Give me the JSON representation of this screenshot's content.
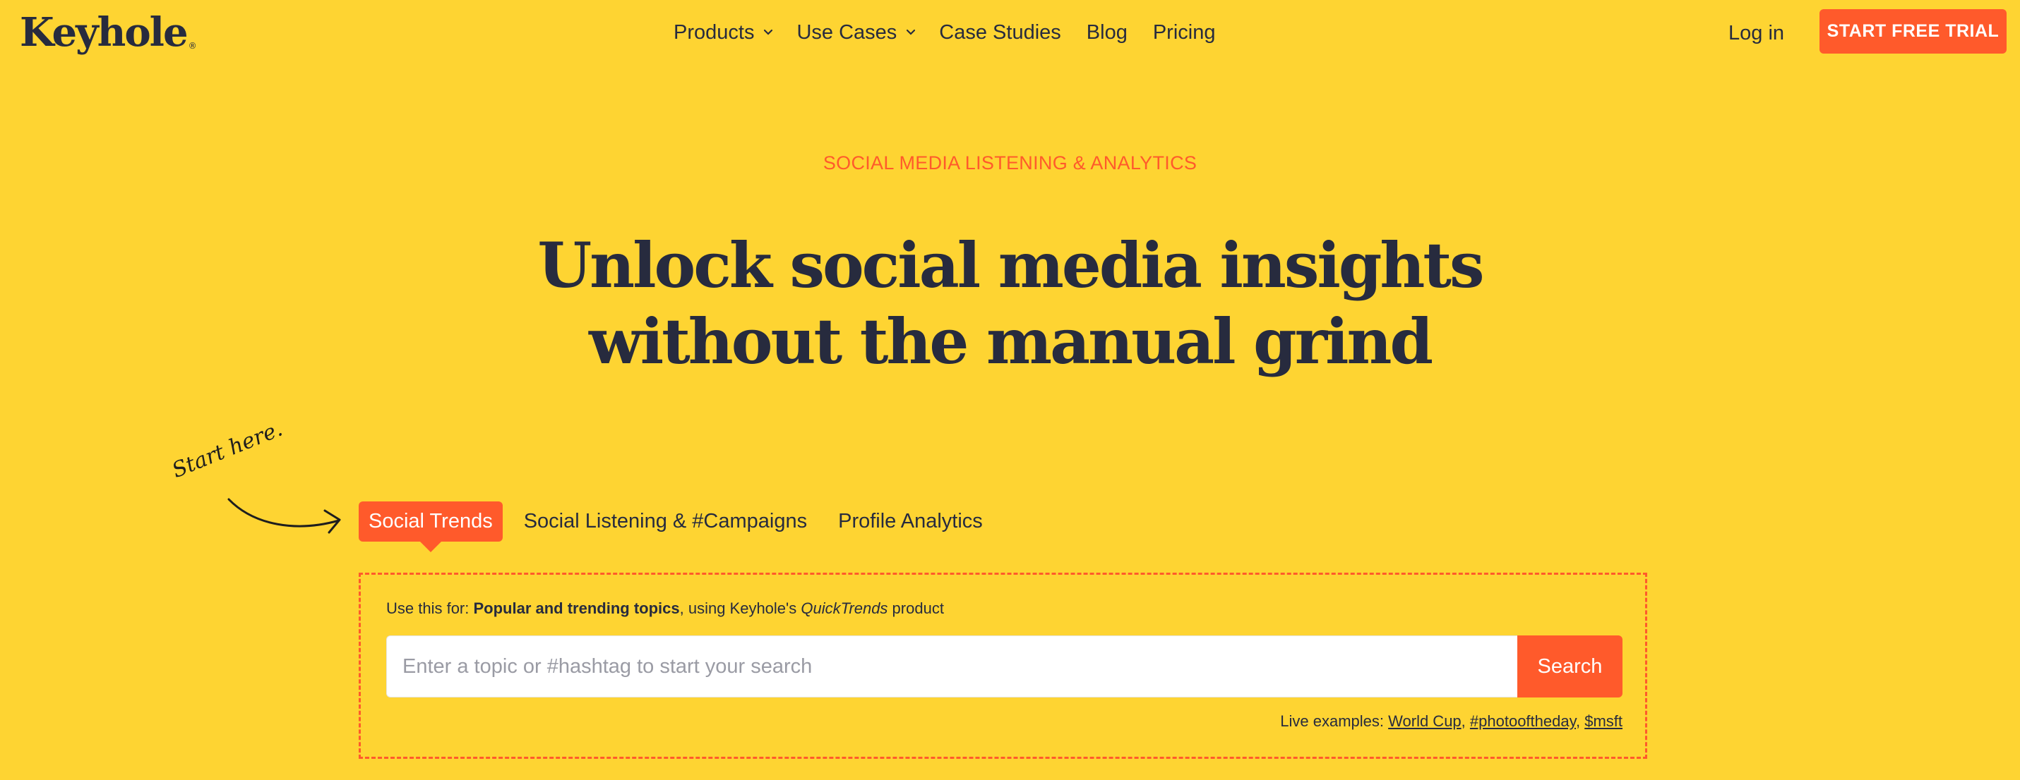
{
  "header": {
    "logo": "Keyhole",
    "logo_mark": "®",
    "nav": [
      {
        "label": "Products",
        "has_dropdown": true
      },
      {
        "label": "Use Cases",
        "has_dropdown": true
      },
      {
        "label": "Case Studies",
        "has_dropdown": false
      },
      {
        "label": "Blog",
        "has_dropdown": false
      },
      {
        "label": "Pricing",
        "has_dropdown": false
      }
    ],
    "login_label": "Log in",
    "cta_label": "START FREE TRIAL"
  },
  "hero": {
    "eyebrow": "SOCIAL MEDIA LISTENING & ANALYTICS",
    "headline_line1": "Unlock social media insights",
    "headline_line2": "without the manual grind"
  },
  "annotation": {
    "start_here": "Start here."
  },
  "tabs": [
    {
      "label": "Social Trends",
      "active": true
    },
    {
      "label": "Social Listening & #Campaigns",
      "active": false
    },
    {
      "label": "Profile Analytics",
      "active": false
    }
  ],
  "panel": {
    "use_for_prefix": "Use this for: ",
    "use_for_bold": "Popular and trending topics",
    "use_for_mid": ", using Keyhole's ",
    "use_for_product": "QuickTrends",
    "use_for_suffix": " product",
    "search_placeholder": "Enter a topic or #hashtag to start your search",
    "search_value": "",
    "search_button": "Search",
    "live_examples_label": "Live examples: ",
    "live_examples": [
      "World Cup",
      "#photooftheday",
      "$msft"
    ],
    "separator": ", "
  },
  "colors": {
    "background": "#FED432",
    "accent": "#FF5A2B",
    "text": "#272B3E"
  }
}
